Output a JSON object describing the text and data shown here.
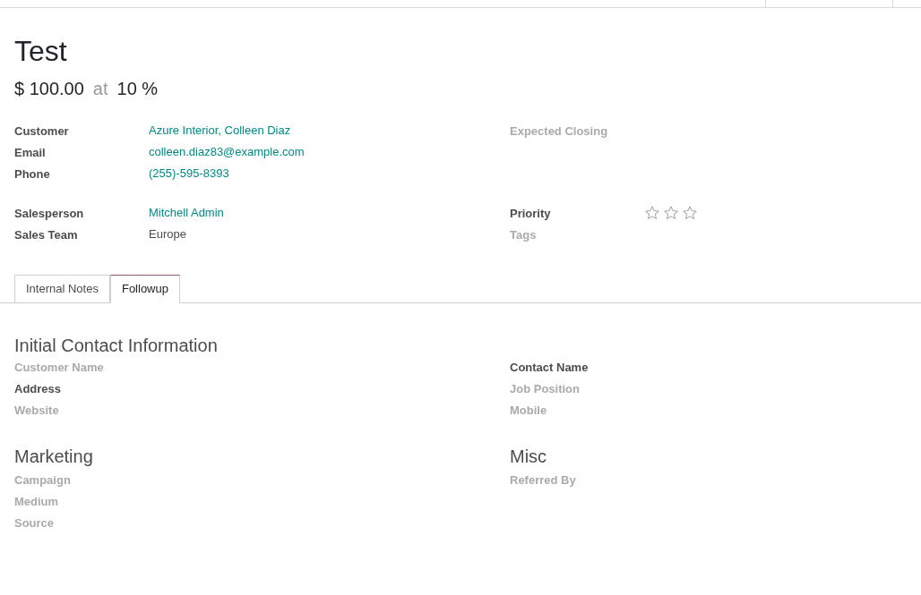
{
  "title": "Test",
  "revenue": {
    "amount": "$ 100.00",
    "at": "at",
    "probability": "10 %"
  },
  "field_groups": [
    {
      "left": [
        {
          "label": "Customer",
          "value": "Azure Interior, Colleen Diaz",
          "empty": false,
          "link": true
        },
        {
          "label": "Email",
          "value": "colleen.diaz83@example.com",
          "empty": false,
          "link": true
        },
        {
          "label": "Phone",
          "value": "(255)-595-8393",
          "empty": false,
          "link": true
        }
      ],
      "right": [
        {
          "label": "Expected Closing",
          "empty": true
        }
      ]
    },
    {
      "left": [
        {
          "label": "Salesperson",
          "value": "Mitchell Admin",
          "empty": false,
          "link": true
        },
        {
          "label": "Sales Team",
          "value": "Europe",
          "empty": false,
          "link": false
        }
      ],
      "right": [
        {
          "label": "Priority",
          "empty": false,
          "kind": "stars",
          "stars": 0
        },
        {
          "label": "Tags",
          "empty": true
        }
      ]
    }
  ],
  "tabs": [
    {
      "label": "Internal Notes",
      "selected": false
    },
    {
      "label": "Followup",
      "selected": true
    }
  ],
  "sections": [
    {
      "heading": "Initial Contact Information",
      "left": {
        "fields": [
          {
            "label": "Customer Name",
            "empty": true
          },
          {
            "label": "Address",
            "empty": false
          },
          {
            "label": "Website",
            "empty": true
          }
        ]
      },
      "right": {
        "fields": [
          {
            "label": "Contact Name",
            "empty": false
          },
          {
            "label": "Job Position",
            "empty": true
          },
          {
            "label": "Mobile",
            "empty": true
          }
        ]
      }
    },
    {
      "left": {
        "heading": "Marketing",
        "fields": [
          {
            "label": "Campaign",
            "empty": true
          },
          {
            "label": "Medium",
            "empty": true
          },
          {
            "label": "Source",
            "empty": true
          }
        ]
      },
      "right": {
        "heading": "Misc",
        "fields": [
          {
            "label": "Referred By",
            "empty": true
          }
        ]
      }
    }
  ]
}
